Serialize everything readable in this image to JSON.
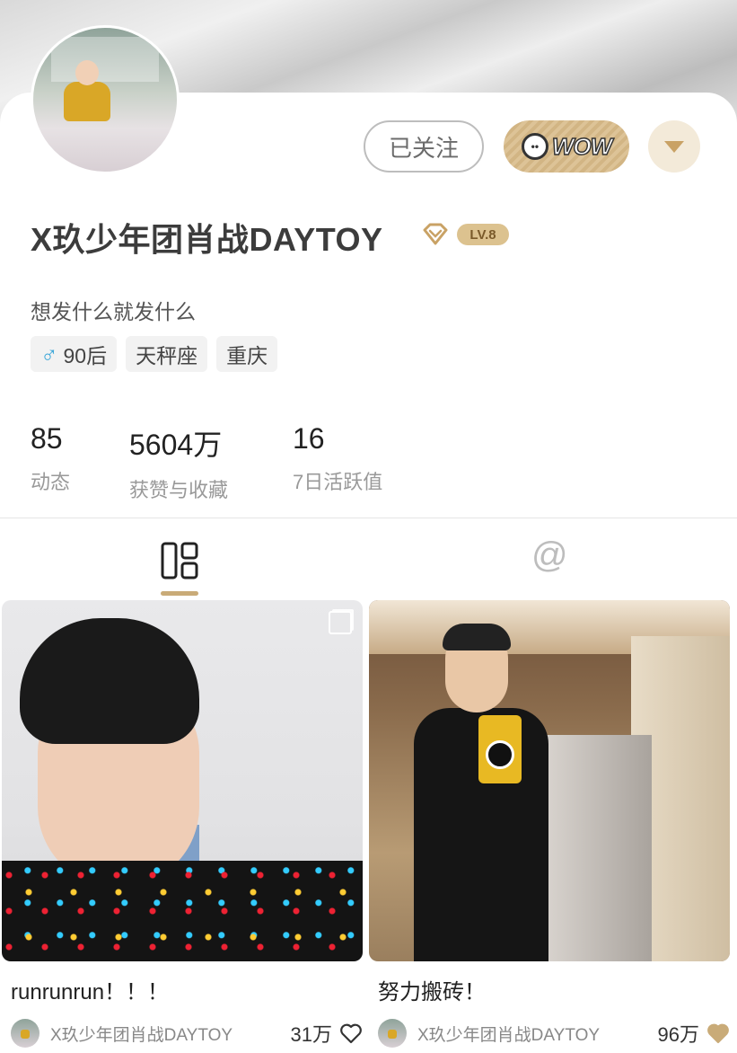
{
  "profile": {
    "name": "X玖少年团肖战DAYTOY",
    "level": "LV.8",
    "bio": "想发什么就发什么",
    "tags": {
      "age": "90后",
      "zodiac": "天秤座",
      "city": "重庆"
    }
  },
  "actions": {
    "follow_label": "已关注",
    "wow_label": "WOW"
  },
  "stats": [
    {
      "value": "85",
      "label": "动态"
    },
    {
      "value": "5604万",
      "label": "获赞与收藏"
    },
    {
      "value": "16",
      "label": "7日活跃值"
    }
  ],
  "tabs": {
    "at_symbol": "@"
  },
  "posts": [
    {
      "title": "runrunrun！！！",
      "author": "X玖少年团肖战DAYTOY",
      "likes": "31万",
      "liked": false
    },
    {
      "title": "努力搬砖！",
      "author": "X玖少年团肖战DAYTOY",
      "likes": "96万",
      "liked": true
    }
  ],
  "colors": {
    "accent_gold": "#c9ab78",
    "male_blue": "#3aa6d8"
  }
}
